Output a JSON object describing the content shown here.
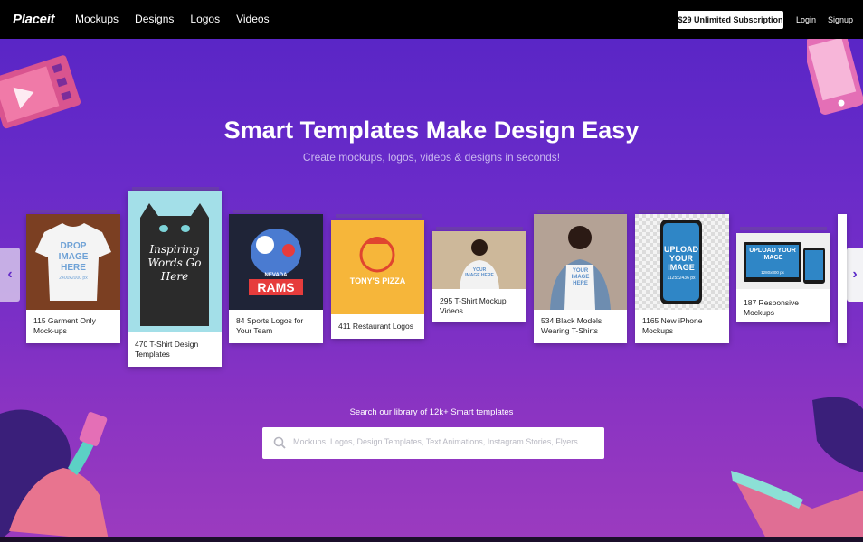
{
  "brand": {
    "logo": "Placeit"
  },
  "nav": {
    "items": [
      "Mockups",
      "Designs",
      "Logos",
      "Videos"
    ]
  },
  "header": {
    "subscription": "$29 Unlimited Subscription",
    "login": "Login",
    "signup": "Signup"
  },
  "hero": {
    "title": "Smart Templates Make Design Easy",
    "subtitle": "Create mockups, logos, videos & designs in seconds!"
  },
  "carousel": {
    "cards": [
      {
        "caption": "115 Garment Only Mock-ups",
        "thumb_text": "DROP IMAGE HERE",
        "thumb_small": "2400x2000 px"
      },
      {
        "caption": "470 T-Shirt Design Templates",
        "thumb_text": "Inspiring Words Go Here"
      },
      {
        "caption": "84 Sports Logos for Your Team",
        "thumb_text": "RAMS",
        "thumb_small": "NEVADA"
      },
      {
        "caption": "411 Restaurant Logos",
        "thumb_text": "TONY'S PIZZA"
      },
      {
        "caption": "295 T-Shirt Mockup Videos",
        "thumb_text": "YOUR IMAGE HERE"
      },
      {
        "caption": "534 Black Models Wearing T-Shirts",
        "thumb_text": "YOUR IMAGE HERE"
      },
      {
        "caption": "1165 New iPhone Mockups",
        "thumb_text": "UPLOAD YOUR IMAGE",
        "thumb_small": "1125x2436 px"
      },
      {
        "caption": "187 Responsive Mockups",
        "thumb_text": "UPLOAD YOUR IMAGE",
        "thumb_small": "1280x800 px"
      }
    ]
  },
  "search": {
    "label": "Search our library of 12k+ Smart templates",
    "placeholder": "Mockups, Logos, Design Templates, Text Animations, Instagram Stories, Flyers"
  },
  "colors": {
    "hero_top": "#5a26c6",
    "hero_bottom": "#9b3bbf",
    "accent_pink": "#e46fb6"
  }
}
